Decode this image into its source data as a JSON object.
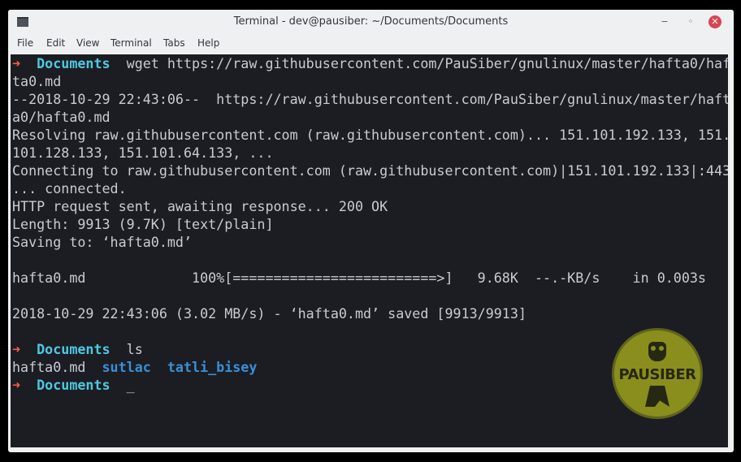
{
  "window": {
    "title": "Terminal - dev@pausiber: ~/Documents/Documents",
    "buttons": {
      "minimize": "−",
      "maximize": "◦",
      "close": "✕"
    }
  },
  "menu": [
    "File",
    "Edit",
    "View",
    "Terminal",
    "Tabs",
    "Help"
  ],
  "terminal": {
    "prompt_arrow": "➜",
    "prompt_dir": "Documents",
    "lines": [
      "wget https://raw.githubusercontent.com/PauSiber/gnulinux/master/hafta0/haf",
      "ta0.md",
      "--2018-10-29 22:43:06--  https://raw.githubusercontent.com/PauSiber/gnulinux/master/haft",
      "a0/hafta0.md",
      "Resolving raw.githubusercontent.com (raw.githubusercontent.com)... 151.101.192.133, 151.",
      "101.128.133, 151.101.64.133, ...",
      "Connecting to raw.githubusercontent.com (raw.githubusercontent.com)|151.101.192.133|:443",
      "... connected.",
      "HTTP request sent, awaiting response... 200 OK",
      "Length: 9913 (9.7K) [text/plain]",
      "Saving to: ‘hafta0.md’",
      "hafta0.md             100%[=========================>]   9.68K  --.-KB/s    in 0.003s",
      "2018-10-29 22:43:06 (3.02 MB/s) - ‘hafta0.md’ saved [9913/9913]",
      "ls"
    ],
    "ls_output": {
      "file": "hafta0.md",
      "dir1": "sutlac",
      "dir2": "tatli_bisey"
    },
    "cursor": "_"
  },
  "watermark": {
    "text": "PAUSIBER"
  }
}
